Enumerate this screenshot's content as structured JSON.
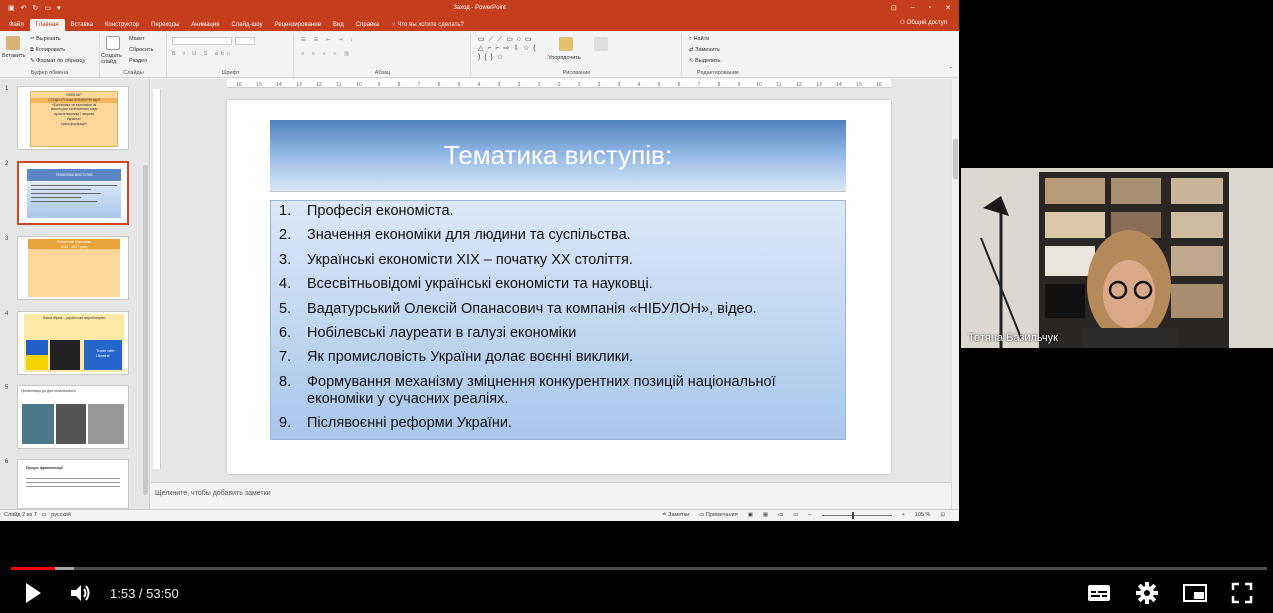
{
  "window": {
    "title": "Заход - PowerPoint",
    "share_label": "Общий доступ"
  },
  "ribbon_tabs": [
    "Файл",
    "Главная",
    "Вставка",
    "Конструктор",
    "Переходы",
    "Анимация",
    "Слайд-шоу",
    "Рецензирование",
    "Вид",
    "Справка"
  ],
  "tell_me": "Что вы хотите сделать?",
  "ribbon": {
    "clipboard": {
      "paste": "Вставить",
      "cut": "Вырезать",
      "copy": "Копировать",
      "format": "Формат по образцу",
      "caption": "Буфер обмена"
    },
    "slides": {
      "new_slide": "Создать слайд",
      "layout": "Макет",
      "reset": "Сбросить",
      "section": "Раздел",
      "caption": "Слайды"
    },
    "font": {
      "caption": "Шрифт"
    },
    "paragraph": {
      "caption": "Абзац"
    },
    "drawing": {
      "arrange": "Упорядочить",
      "caption": "Рисование"
    },
    "editing": {
      "find": "Найти",
      "replace": "Заменить",
      "select": "Выделить",
      "caption": "Редактирование"
    }
  },
  "ruler_ticks": [
    "16",
    "15",
    "14",
    "13",
    "12",
    "11",
    "10",
    "9",
    "8",
    "7",
    "6",
    "5",
    "4",
    "3",
    "2",
    "1",
    "0",
    "1",
    "2",
    "3",
    "4",
    "5",
    "6",
    "7",
    "8",
    "9",
    "10",
    "11",
    "12",
    "13",
    "14",
    "15",
    "16"
  ],
  "thumbnails": [
    {
      "num": "1",
      "lines": [
        "ВЕБІНАР",
        "СТУДЕНТСЬКА КОНФЕРЕНЦІЯ",
        "«Економіка та економіка як",
        "мистецтво економічних наук",
        "сучасні виклики і загрози",
        "Україна»",
        "трансформації»"
      ]
    },
    {
      "num": "2",
      "lines": [
        "ТЕМАТИКА ВИСТУПІВ"
      ]
    },
    {
      "num": "3",
      "lines": [
        "Рейтингові показники",
        "2022 - 2027 роки"
      ]
    },
    {
      "num": "4",
      "lines": [
        "Наша зброя – українське виробництво",
        "Trade with Ukraine"
      ]
    },
    {
      "num": "5",
      "lines": [
        "Презентація до Дня незалежності"
      ]
    },
    {
      "num": "6",
      "lines": [
        "Процес фрагментації"
      ]
    }
  ],
  "slide": {
    "title": "Тематика виступів:",
    "items": [
      {
        "n": "1.",
        "text": "Професія економіста."
      },
      {
        "n": "2.",
        "text": "Значення економіки для людини та суспільства."
      },
      {
        "n": "3.",
        "text": "Українські економісти XIX – початку XX століття."
      },
      {
        "n": "4.",
        "text": "Всесвітньовідомі українські економісти та науковці."
      },
      {
        "n": "5.",
        "text": "Вадатурський Олексій Опанасович та компанія «НІБУЛОН», відео."
      },
      {
        "n": "6.",
        "text": "Нобілевські лауреати в галузі економіки"
      },
      {
        "n": "7.",
        "text": "Як промисловість України долає воєнні виклики."
      },
      {
        "n": "8.",
        "text": "Формування механізму зміцнення конкурентних позицій національної економіки у сучасних реаліях."
      },
      {
        "n": "9.",
        "text": "Післявоєнні реформи України."
      }
    ]
  },
  "notes_placeholder": "Щелкните, чтобы добавить заметки",
  "status": {
    "slide_counter": "Слайд 2 из 7",
    "language": "русский",
    "notes": "Заметки",
    "comments": "Примечания",
    "zoom": "105 %"
  },
  "webcam": {
    "name": "Тетяна Базильчук"
  },
  "player": {
    "current_time": "1:53",
    "duration": "53:50",
    "progress_fraction": 0.035
  },
  "colors": {
    "ppt_accent": "#c43e1c",
    "progress_played": "#ff0000"
  }
}
